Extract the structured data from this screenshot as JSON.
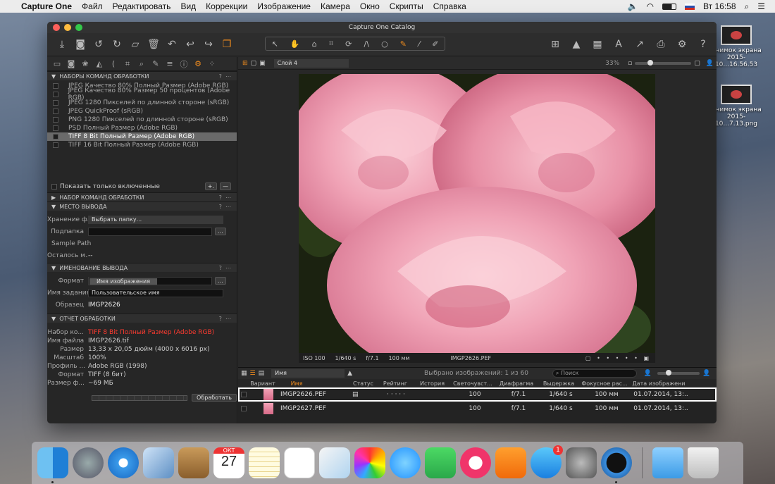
{
  "menubar": {
    "app": "Capture One",
    "items": [
      "Файл",
      "Редактировать",
      "Вид",
      "Коррекции",
      "Изображение",
      "Камера",
      "Окно",
      "Скрипты",
      "Справка"
    ],
    "time": "Вт 16:58"
  },
  "desktop": {
    "icon1": "Снимок экрана\n2015-10...16.56.53",
    "icon2": "Снимок экрана\n2015-10...7.13.png"
  },
  "window": {
    "title": "Capture One Catalog"
  },
  "panel": {
    "process_recipes_title": "НАБОРЫ КОМАНД ОБРАБОТКИ",
    "recipes": [
      "JPEG Качество 80% Полный Размер (Adobe RGB)",
      "JPEG Качество 80% Размер 50 процентов (Adobe RGB)",
      "JPEG 1280 Пикселей по длинной стороне (sRGB)",
      "JPEG QuickProof (sRGB)",
      "PNG 1280 Пикселей по длинной стороне (sRGB)",
      "PSD Полный Размер (Adobe RGB)",
      "TIFF 8 Bit Полный Размер (Adobe RGB)",
      "TIFF 16 Bit Полный Размер (Adobe RGB)"
    ],
    "show_enabled": "Показать только включенные",
    "recipe_section": "НАБОР КОМАНД ОБРАБОТКИ",
    "output_section": "МЕСТО ВЫВОДА",
    "storage_label": "Хранение ф...",
    "storage_value": "Выбрать папку...",
    "subfolder_label": "Подпапка",
    "sample_path_label": "Sample Path",
    "remaining_label": "Осталось м...",
    "remaining_value": "--",
    "naming_section": "ИМЕНОВАНИЕ ВЫВОДА",
    "format_label": "Формат",
    "format_token": "Имя изображения",
    "jobname_label": "Имя задания",
    "jobname_value": "Пользовательское имя",
    "sample_label": "Образец",
    "sample_value": "IMGP2626",
    "summary_section": "ОТЧЕТ ОБРАБОТКИ",
    "summary": [
      {
        "k": "Набор ко...",
        "v": "TIFF 8 Bit Полный Размер (Adobe RGB)"
      },
      {
        "k": "Имя файла",
        "v": "IMGP2626.tif"
      },
      {
        "k": "Размер",
        "v": "13,33 x 20,05 дюйм (4000 x 6016 px)"
      },
      {
        "k": "Масштаб",
        "v": "100%"
      },
      {
        "k": "Профиль ...",
        "v": "Adobe RGB (1998)"
      },
      {
        "k": "Формат",
        "v": "TIFF (8 бит)"
      },
      {
        "k": "Размер ф...",
        "v": "~69 МБ"
      }
    ],
    "process_btn": "Обработать"
  },
  "viewer": {
    "layer": "Слой 4",
    "zoom": "33%",
    "iso": "ISO 100",
    "shutter": "1/640 s",
    "aperture": "f/7.1",
    "focal": "100 мм",
    "filename": "IMGP2626.PEF"
  },
  "browser": {
    "sort": "Имя",
    "selected": "Выбрано изображений: 1 из 60",
    "search_placeholder": "Поиск",
    "columns": [
      "Вариант",
      "Имя",
      "Статус",
      "Рейтинг",
      "История",
      "Светочувст...",
      "Диафрагма",
      "Выдержка",
      "Фокусное рас...",
      "Дата изображени"
    ],
    "rows": [
      {
        "name": "IMGP2626.PEF",
        "rating": "· · · · ·",
        "iso": "100",
        "ap": "f/7.1",
        "sh": "1/640 s",
        "focal": "100 мм",
        "date": "01.07.2014, 13:.."
      },
      {
        "name": "IMGP2627.PEF",
        "rating": "",
        "iso": "100",
        "ap": "f/7.1",
        "sh": "1/640 s",
        "focal": "100 мм",
        "date": "01.07.2014, 13:.."
      }
    ]
  },
  "dock": {
    "calendar_month": "ОКТ",
    "calendar_day": "27",
    "appstore_badge": "1"
  },
  "colors": {
    "accent": "#f08c1e",
    "summary_red": "#ff3b30"
  }
}
